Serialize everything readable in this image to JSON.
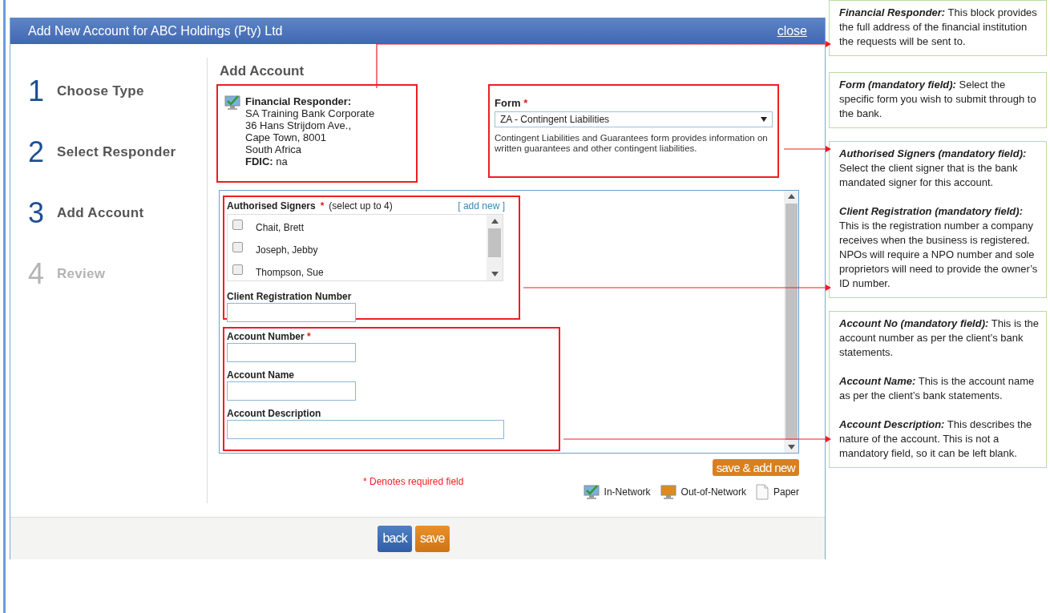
{
  "dialog": {
    "title": "Add New Account for ABC Holdings (Pty) Ltd",
    "close_label": "close",
    "steps": [
      {
        "number": "1",
        "label": "Choose Type",
        "disabled": false
      },
      {
        "number": "2",
        "label": "Select Responder",
        "disabled": false
      },
      {
        "number": "3",
        "label": "Add Account",
        "disabled": false
      },
      {
        "number": "4",
        "label": "Review",
        "disabled": true
      }
    ],
    "heading": "Add Account",
    "responder": {
      "label": "Financial Responder:",
      "lines": [
        "SA Training Bank Corporate",
        "36 Hans Strijdom Ave.,",
        "Cape Town, 8001",
        "South Africa"
      ],
      "fdic": "**FDIC:** na"
    },
    "form": {
      "label": "Form",
      "required_mark": "*",
      "value": "ZA - Contingent Liabilities",
      "description": "Contingent Liabilities and Guarantees form provides information on written guarantees and other contingent liabilities."
    },
    "signers": {
      "label": "Authorised Signers",
      "required_mark": "*",
      "hint": "(select up to 4)",
      "add_link": "[ add new ]",
      "items": [
        {
          "name": "Chait, Brett",
          "checked": false
        },
        {
          "name": "Joseph, Jebby",
          "checked": false
        },
        {
          "name": "Thompson, Sue",
          "checked": false
        }
      ]
    },
    "registration": {
      "label": "Client Registration Number"
    },
    "account_fields": [
      {
        "label": "Account Number",
        "required_mark": "*",
        "kind": "short"
      },
      {
        "label": "Account Name",
        "kind": "short"
      },
      {
        "label": "Account Description",
        "kind": "long"
      }
    ],
    "save_add_new": "save & add new",
    "required_note": "* Denotes required field",
    "legend": [
      {
        "kind": "in-network",
        "label": "In-Network"
      },
      {
        "kind": "out-of-network",
        "label": "Out-of-Network"
      },
      {
        "kind": "paper",
        "label": "Paper"
      }
    ],
    "buttons": [
      {
        "kind": "back",
        "label": "back"
      },
      {
        "kind": "save",
        "label": "save"
      }
    ]
  },
  "callouts": [
    {
      "paragraphs": [
        "*Financial Responder:* This block provides the full address of the financial institution the requests will be sent to."
      ]
    },
    {
      "paragraphs": [
        "*Form (mandatory field):* Select the specific form you wish to submit through to the bank."
      ]
    },
    {
      "paragraphs": [
        "*Authorised Signers (mandatory field):* Select the client signer that is the bank mandated signer for this account.",
        "*Client Registration (mandatory field):* This is the registration number a company receives when the business is registered. NPOs will require a NPO number and sole proprietors will need to provide the owner’s ID number."
      ]
    },
    {
      "paragraphs": [
        "*Account No (mandatory field):* This is the account number as per the client’s bank statements.",
        "*Account Name:* This is the account name as per the client’s bank statements.",
        "*Account Description:* This describes the nature of the account. This is not a mandatory field, so it can be left blank."
      ]
    }
  ]
}
